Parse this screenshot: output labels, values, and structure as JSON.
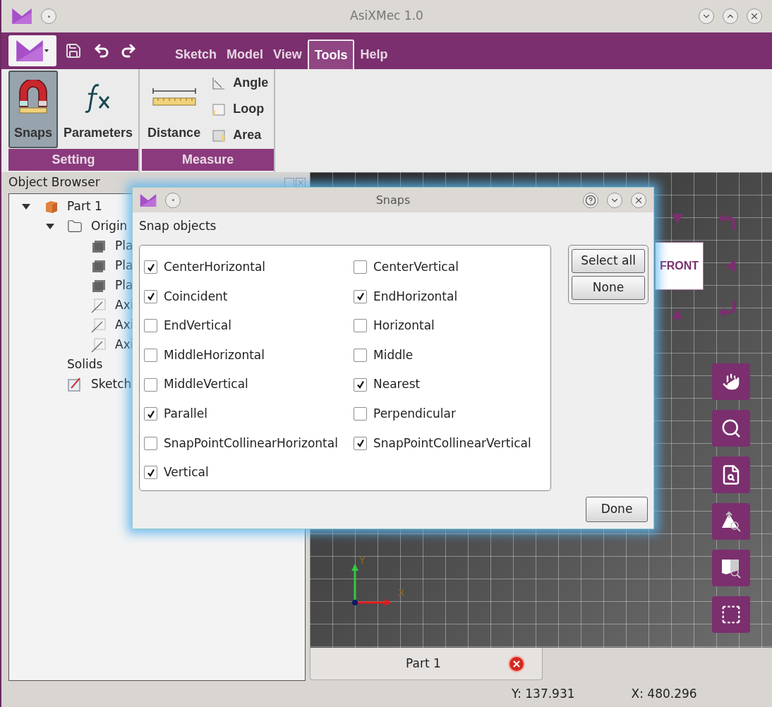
{
  "window": {
    "title": "AsiXMec 1.0"
  },
  "menu": [
    {
      "label": "Sketch",
      "selected": false
    },
    {
      "label": "Model",
      "selected": false
    },
    {
      "label": "View",
      "selected": false
    },
    {
      "label": "Tools",
      "selected": true
    },
    {
      "label": "Help",
      "selected": false
    }
  ],
  "ribbon": [
    {
      "label": "Setting",
      "items": [
        {
          "label": "Snaps",
          "kind": "large",
          "pressed": true
        },
        {
          "label": "Parameters",
          "kind": "large",
          "pressed": false
        }
      ]
    },
    {
      "label": "Measure",
      "items": [
        {
          "label": "Distance",
          "kind": "large",
          "pressed": false
        },
        {
          "label": "Angle",
          "kind": "small",
          "pressed": false
        },
        {
          "label": "Loop",
          "kind": "small",
          "pressed": false
        },
        {
          "label": "Area",
          "kind": "small",
          "pressed": false
        }
      ]
    }
  ],
  "object_browser": {
    "title": "Object Browser",
    "tree": [
      {
        "label": "Part 1",
        "kind": "part",
        "expanded": true,
        "children": [
          {
            "label": "Origin",
            "kind": "folder",
            "expanded": true,
            "children": [
              {
                "label": "Pla",
                "kind": "plane"
              },
              {
                "label": "Pla",
                "kind": "plane"
              },
              {
                "label": "Pla",
                "kind": "plane"
              },
              {
                "label": "Axi",
                "kind": "axis"
              },
              {
                "label": "Axi",
                "kind": "axis"
              },
              {
                "label": "Axi",
                "kind": "axis"
              }
            ]
          },
          {
            "label": "Solids",
            "kind": "group"
          },
          {
            "label": "Sketch",
            "kind": "sketch"
          }
        ]
      }
    ]
  },
  "dialog": {
    "title": "Snaps",
    "section": "Snap objects",
    "options": [
      {
        "label": "CenterHorizontal",
        "checked": true
      },
      {
        "label": "CenterVertical",
        "checked": false
      },
      {
        "label": "Coincident",
        "checked": true
      },
      {
        "label": "EndHorizontal",
        "checked": true
      },
      {
        "label": "EndVertical",
        "checked": false
      },
      {
        "label": "Horizontal",
        "checked": false
      },
      {
        "label": "MiddleHorizontal",
        "checked": false
      },
      {
        "label": "Middle",
        "checked": false
      },
      {
        "label": "MiddleVertical",
        "checked": false
      },
      {
        "label": "Nearest",
        "checked": true
      },
      {
        "label": "Parallel",
        "checked": true
      },
      {
        "label": "Perpendicular",
        "checked": false
      },
      {
        "label": "SnapPointCollinearHorizontal",
        "checked": false
      },
      {
        "label": "SnapPointCollinearVertical",
        "checked": true
      },
      {
        "label": "Vertical",
        "checked": true
      }
    ],
    "side_buttons": [
      "Select all",
      "None"
    ],
    "done_button": "Done"
  },
  "viewport": {
    "view_cube": "FRONT",
    "axis_labels": [
      "Y",
      "X"
    ]
  },
  "document_tabs": [
    {
      "label": "Part 1",
      "selected": true
    }
  ],
  "status_bar": {
    "y": "Y: 137.931",
    "x": "X: 480.296"
  }
}
